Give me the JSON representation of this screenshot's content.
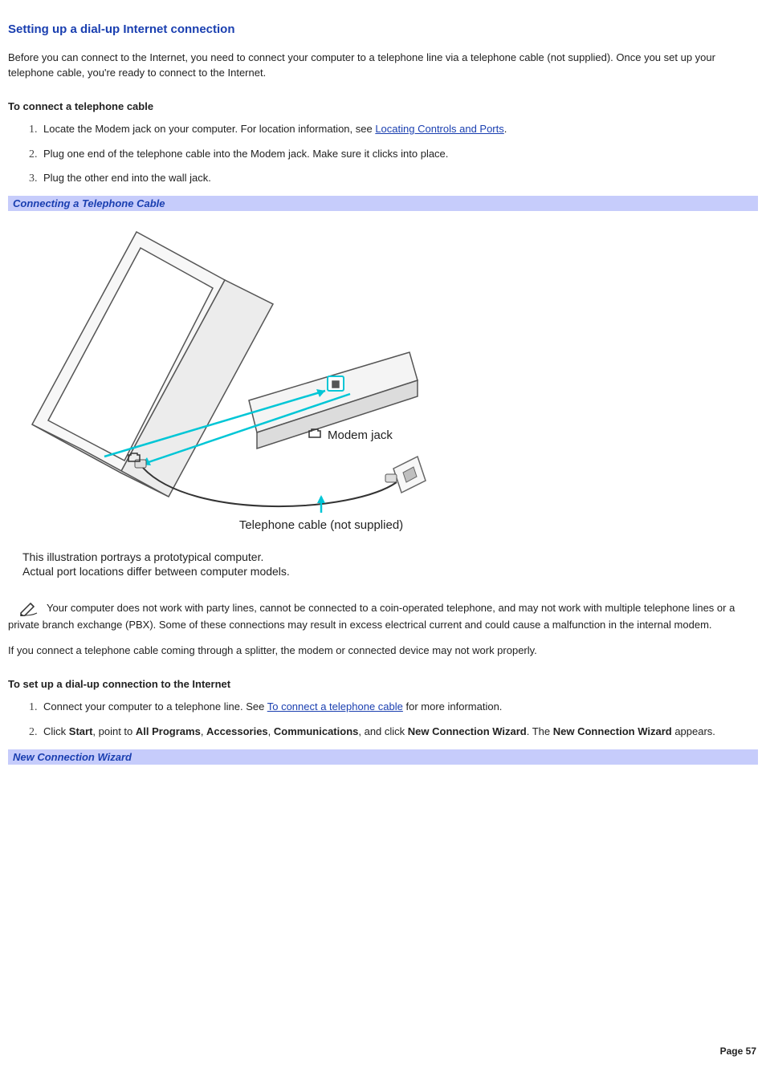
{
  "heading": "Setting up a dial-up Internet connection",
  "intro": "Before you can connect to the Internet, you need to connect your computer to a telephone line via a telephone cable (not supplied). Once you set up your telephone cable, you're ready to connect to the Internet.",
  "section1_title": "To connect a telephone cable",
  "steps1": {
    "s1_pre": "Locate the Modem jack on your computer. For location information, see ",
    "s1_link": "Locating Controls and Ports",
    "s1_post": ".",
    "s2": "Plug one end of the telephone cable into the Modem jack. Make sure it clicks into place.",
    "s3": "Plug the other end into the wall jack."
  },
  "figure1_title": "Connecting a Telephone Cable",
  "fig1": {
    "modem_label": "Modem jack",
    "cable_label": "Telephone cable (not supplied)",
    "note_line1": "This illustration portrays a prototypical computer.",
    "note_line2": "Actual port locations differ between computer models."
  },
  "note_para": "Your computer does not work with party lines, cannot be connected to a coin-operated telephone, and may not work with multiple telephone lines or a private branch exchange (PBX). Some of these connections may result in excess electrical current and could cause a malfunction in the internal modem.",
  "splitter_para": "If you connect a telephone cable coming through a splitter, the modem or connected device may not work properly.",
  "section2_title": "To set up a dial-up connection to the Internet",
  "steps2": {
    "s1_pre": "Connect your computer to a telephone line. See ",
    "s1_link": "To connect a telephone cable",
    "s1_post": " for more information.",
    "s2_click": "Click ",
    "s2_start": "Start",
    "s2_t1": ", point to ",
    "s2_allprograms": "All Programs",
    "s2_c1": ", ",
    "s2_accessories": "Accessories",
    "s2_c2": ", ",
    "s2_comm": "Communications",
    "s2_t2": ", and click ",
    "s2_ncw": "New Connection Wizard",
    "s2_t3": ". The ",
    "s2_ncw2": "New Connection Wizard",
    "s2_t4": " appears."
  },
  "figure2_title": "New Connection Wizard",
  "page_number": "Page 57"
}
